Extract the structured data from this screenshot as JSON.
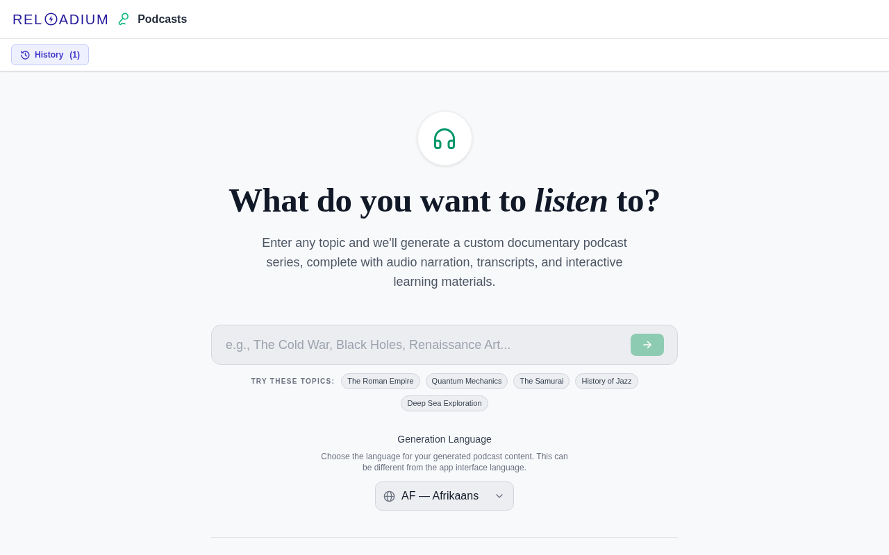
{
  "header": {
    "logo": {
      "text_before_icon": "REL",
      "text_after_icon": "ADIUM"
    },
    "app_title": "Podcasts"
  },
  "toolbar": {
    "history_button": {
      "label": "History",
      "count": "(1)"
    }
  },
  "hero": {
    "headline": "What do you want to *listen* to?",
    "description": "Enter any topic and we'll generate a custom documentary podcast series, complete with audio narration, transcripts, and interactive learning materials."
  },
  "topic_search": {
    "placeholder": "e.g., The Cold War, Black Holes, Renaissance Art...",
    "submit_disabled": true
  },
  "suggestions": {
    "label": "TRY THESE TOPICS:",
    "topics": [
      "The Roman Empire",
      "Quantum Mechanics",
      "The Samurai",
      "History of Jazz",
      "Deep Sea Exploration"
    ]
  },
  "language": {
    "title": "Generation Language",
    "description": "Choose the language for your generated podcast content. This can be different from the app interface language.",
    "selected": "AF — Afrikaans"
  }
}
